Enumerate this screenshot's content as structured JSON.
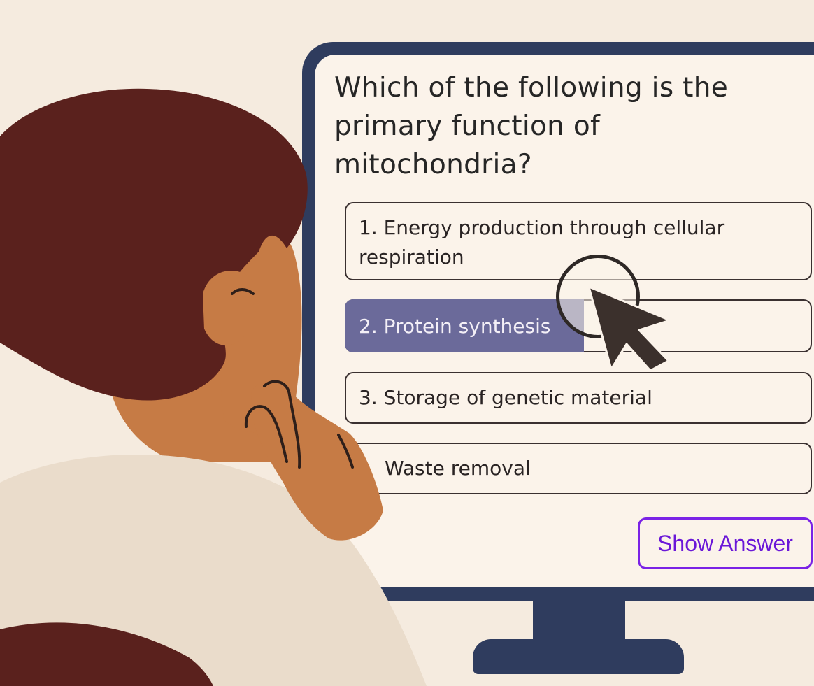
{
  "quiz": {
    "question": "Which of the following is the primary function of mitochondria?",
    "options": [
      {
        "label": "1. Energy production through cellular respiration"
      },
      {
        "label": "2. Protein synthesis",
        "selected": true
      },
      {
        "label": "3. Storage of genetic material"
      },
      {
        "label": "Waste removal"
      }
    ],
    "show_answer_label": "Show Answer"
  },
  "colors": {
    "background": "#f5ebdf",
    "monitor": "#2f3c5e",
    "screen": "#fbf3ea",
    "selected_option": "#6b6a9a",
    "accent": "#7a22e6"
  },
  "icons": {
    "pointer": "mouse-pointer-icon"
  }
}
